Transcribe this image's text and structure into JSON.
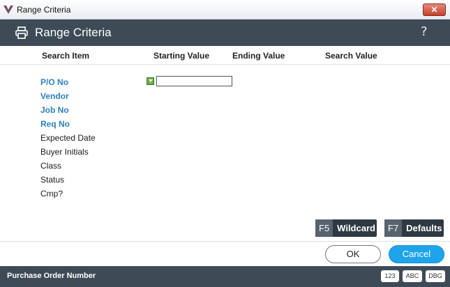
{
  "window": {
    "title": "Range Criteria",
    "close_label": "✕"
  },
  "header": {
    "title": "Range Criteria",
    "help_label": "?"
  },
  "columns": {
    "search_item": "Search Item",
    "starting_value": "Starting Value",
    "ending_value": "Ending Value",
    "search_value": "Search Value"
  },
  "rows": [
    {
      "label": "P/O No"
    },
    {
      "label": "Vendor"
    },
    {
      "label": "Job No"
    },
    {
      "label": "Req No"
    },
    {
      "label": "Expected Date"
    },
    {
      "label": "Buyer Initials"
    },
    {
      "label": "Class"
    },
    {
      "label": "Status"
    },
    {
      "label": "Cmp?"
    }
  ],
  "active_field": {
    "value": ""
  },
  "function_keys": [
    {
      "key": "F5",
      "label": "Wildcard"
    },
    {
      "key": "F7",
      "label": "Defaults"
    }
  ],
  "buttons": {
    "ok": "OK",
    "cancel": "Cancel"
  },
  "status": {
    "text": "Purchase Order Number",
    "indicators": [
      "123",
      "ABC",
      "DBG"
    ]
  },
  "colors": {
    "header_bg": "#3e4b57",
    "key_field": "#2d7fc0",
    "primary_button": "#1da4ea"
  }
}
